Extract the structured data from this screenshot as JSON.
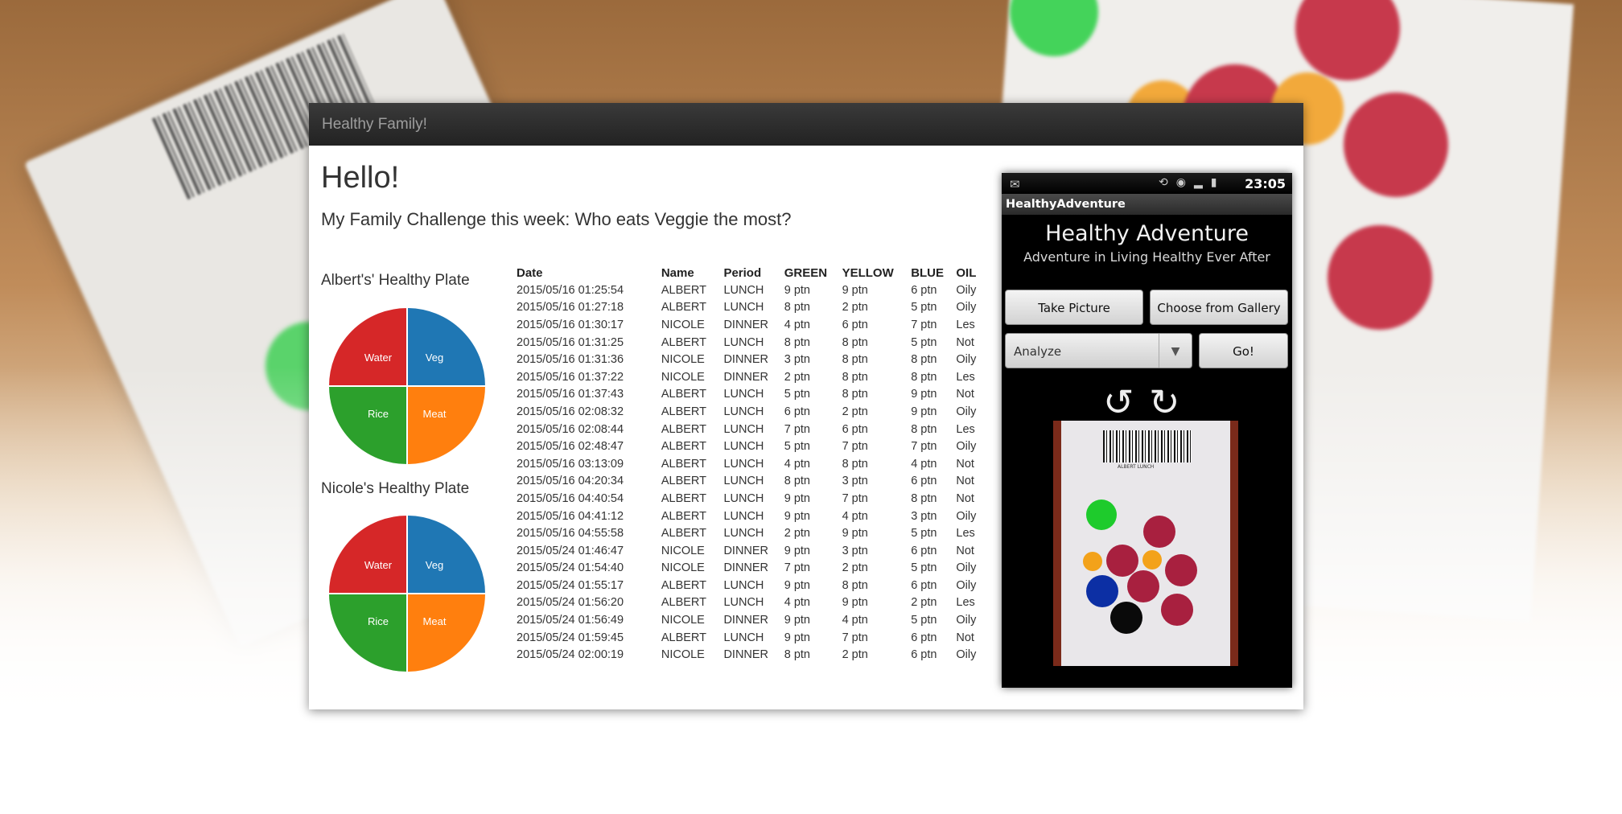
{
  "window": {
    "title": "Healthy Family!"
  },
  "page": {
    "heading": "Hello!",
    "challenge": "My Family Challenge this week: Who eats Veggie the most?"
  },
  "plates": [
    {
      "title": "Albert's' Healthy Plate",
      "slices": [
        "Water",
        "Veg",
        "Rice",
        "Meat"
      ]
    },
    {
      "title": "Nicole's Healthy Plate",
      "slices": [
        "Water",
        "Veg",
        "Rice",
        "Meat"
      ]
    }
  ],
  "plate_colors": {
    "Water": "#d62728",
    "Veg": "#1f77b4",
    "Rice": "#2ca02c",
    "Meat": "#ff7f0e"
  },
  "table": {
    "headers": [
      "Date",
      "Name",
      "Period",
      "GREEN",
      "YELLOW",
      "BLUE",
      "OIL"
    ],
    "rows": [
      [
        "2015/05/16 01:25:54",
        "ALBERT",
        "LUNCH",
        "9 ptn",
        "9 ptn",
        "6 ptn",
        "Oily"
      ],
      [
        "2015/05/16 01:27:18",
        "ALBERT",
        "LUNCH",
        "8 ptn",
        "2 ptn",
        "5 ptn",
        "Oily"
      ],
      [
        "2015/05/16 01:30:17",
        "NICOLE",
        "DINNER",
        "4 ptn",
        "6 ptn",
        "7 ptn",
        "Les"
      ],
      [
        "2015/05/16 01:31:25",
        "ALBERT",
        "LUNCH",
        "8 ptn",
        "8 ptn",
        "5 ptn",
        "Not"
      ],
      [
        "2015/05/16 01:31:36",
        "NICOLE",
        "DINNER",
        "3 ptn",
        "8 ptn",
        "8 ptn",
        "Oily"
      ],
      [
        "2015/05/16 01:37:22",
        "NICOLE",
        "DINNER",
        "2 ptn",
        "8 ptn",
        "8 ptn",
        "Les"
      ],
      [
        "2015/05/16 01:37:43",
        "ALBERT",
        "LUNCH",
        "5 ptn",
        "8 ptn",
        "9 ptn",
        "Not"
      ],
      [
        "2015/05/16 02:08:32",
        "ALBERT",
        "LUNCH",
        "6 ptn",
        "2 ptn",
        "9 ptn",
        "Oily"
      ],
      [
        "2015/05/16 02:08:44",
        "ALBERT",
        "LUNCH",
        "7 ptn",
        "6 ptn",
        "8 ptn",
        "Les"
      ],
      [
        "2015/05/16 02:48:47",
        "ALBERT",
        "LUNCH",
        "5 ptn",
        "7 ptn",
        "7 ptn",
        "Oily"
      ],
      [
        "2015/05/16 03:13:09",
        "ALBERT",
        "LUNCH",
        "4 ptn",
        "8 ptn",
        "4 ptn",
        "Not"
      ],
      [
        "2015/05/16 04:20:34",
        "ALBERT",
        "LUNCH",
        "8 ptn",
        "3 ptn",
        "6 ptn",
        "Not"
      ],
      [
        "2015/05/16 04:40:54",
        "ALBERT",
        "LUNCH",
        "9 ptn",
        "7 ptn",
        "8 ptn",
        "Not"
      ],
      [
        "2015/05/16 04:41:12",
        "ALBERT",
        "LUNCH",
        "9 ptn",
        "4 ptn",
        "3 ptn",
        "Oily"
      ],
      [
        "2015/05/16 04:55:58",
        "ALBERT",
        "LUNCH",
        "2 ptn",
        "9 ptn",
        "5 ptn",
        "Les"
      ],
      [
        "2015/05/24 01:46:47",
        "NICOLE",
        "DINNER",
        "9 ptn",
        "3 ptn",
        "6 ptn",
        "Not"
      ],
      [
        "2015/05/24 01:54:40",
        "NICOLE",
        "DINNER",
        "7 ptn",
        "2 ptn",
        "5 ptn",
        "Oily"
      ],
      [
        "2015/05/24 01:55:17",
        "ALBERT",
        "LUNCH",
        "9 ptn",
        "8 ptn",
        "6 ptn",
        "Oily"
      ],
      [
        "2015/05/24 01:56:20",
        "ALBERT",
        "LUNCH",
        "4 ptn",
        "9 ptn",
        "2 ptn",
        "Les"
      ],
      [
        "2015/05/24 01:56:49",
        "NICOLE",
        "DINNER",
        "9 ptn",
        "4 ptn",
        "5 ptn",
        "Oily"
      ],
      [
        "2015/05/24 01:59:45",
        "ALBERT",
        "LUNCH",
        "9 ptn",
        "7 ptn",
        "6 ptn",
        "Not"
      ],
      [
        "2015/05/24 02:00:19",
        "NICOLE",
        "DINNER",
        "8 ptn",
        "2 ptn",
        "6 ptn",
        "Oily"
      ]
    ]
  },
  "phone": {
    "status_time": "23:05",
    "app_label": "HealthyAdventure",
    "title": "Healthy Adventure",
    "subtitle": "Adventure in Living Healthy Ever After",
    "take_picture": "Take Picture",
    "choose_gallery": "Choose from Gallery",
    "spinner_value": "Analyze",
    "go": "Go!",
    "photo_caption": "ALBERT LUNCH"
  }
}
